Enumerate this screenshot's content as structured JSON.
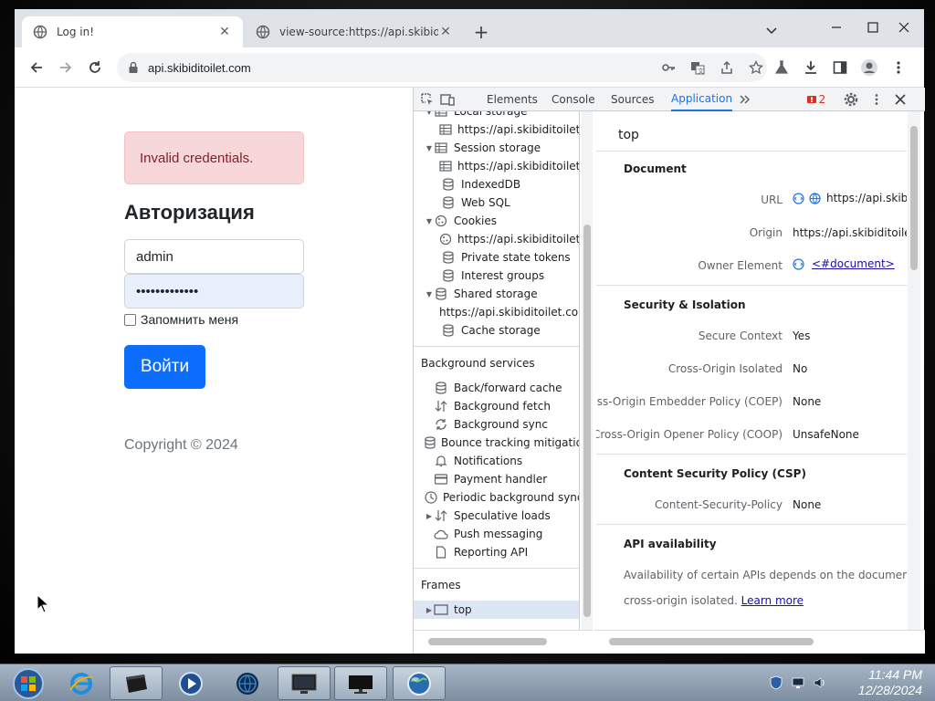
{
  "browser": {
    "tabs": [
      {
        "title": "Log in!",
        "active": true
      },
      {
        "title": "view-source:https://api.skibiditoilet.com",
        "active": false
      }
    ],
    "address": "api.skibiditoilet.com"
  },
  "page": {
    "alert": "Invalid credentials.",
    "title": "Авторизация",
    "username_value": "admin",
    "password_value": "•••••••••••••",
    "remember_label": "Запомнить меня",
    "submit_label": "Войти",
    "copyright": "Copyright © 2024"
  },
  "devtools": {
    "tabs": [
      "Elements",
      "Console",
      "Sources",
      "Application"
    ],
    "active_tab": "Application",
    "issues_count": "2",
    "storage_tree": [
      {
        "label": "Local storage",
        "icon": "table-icon",
        "expanded": true
      },
      {
        "label": "https://api.skibiditoilet.com",
        "icon": "table-icon"
      },
      {
        "label": "Session storage",
        "icon": "table-icon",
        "expanded": true
      },
      {
        "label": "https://api.skibiditoilet.com",
        "icon": "table-icon"
      },
      {
        "label": "IndexedDB",
        "icon": "database-icon"
      },
      {
        "label": "Web SQL",
        "icon": "database-icon"
      },
      {
        "label": "Cookies",
        "icon": "cookie-icon",
        "expanded": true
      },
      {
        "label": "https://api.skibiditoilet.com",
        "icon": "cookie-icon"
      },
      {
        "label": "Private state tokens",
        "icon": "database-icon"
      },
      {
        "label": "Interest groups",
        "icon": "database-icon"
      },
      {
        "label": "Shared storage",
        "icon": "database-icon",
        "expanded": true
      },
      {
        "label": "https://api.skibiditoilet.com",
        "icon": ""
      },
      {
        "label": "Cache storage",
        "icon": "database-icon"
      }
    ],
    "background_services_heading": "Background services",
    "background_services": [
      {
        "label": "Back/forward cache",
        "icon": "database-icon"
      },
      {
        "label": "Background fetch",
        "icon": "arrows-icon"
      },
      {
        "label": "Background sync",
        "icon": "sync-icon"
      },
      {
        "label": "Bounce tracking mitigations",
        "icon": "database-icon"
      },
      {
        "label": "Notifications",
        "icon": "bell-icon"
      },
      {
        "label": "Payment handler",
        "icon": "card-icon"
      },
      {
        "label": "Periodic background sync",
        "icon": "clock-icon"
      },
      {
        "label": "Speculative loads",
        "icon": "arrows-icon"
      },
      {
        "label": "Push messaging",
        "icon": "cloud-icon"
      },
      {
        "label": "Reporting API",
        "icon": "file-icon"
      }
    ],
    "frames_heading": "Frames",
    "frames_top": "top",
    "detail": {
      "title": "top",
      "document_heading": "Document",
      "url_label": "URL",
      "url_value": "https://api.skibiditoilet.com/",
      "origin_label": "Origin",
      "origin_value": "https://api.skibiditoilet.com",
      "owner_label": "Owner Element",
      "owner_value": "<#document>",
      "security_heading": "Security & Isolation",
      "secure_context_label": "Secure Context",
      "secure_context_value": "Yes",
      "coi_label": "Cross-Origin Isolated",
      "coi_value": "No",
      "coep_label": "Cross-Origin Embedder Policy (COEP)",
      "coep_value": "None",
      "coop_label": "Cross-Origin Opener Policy (COOP)",
      "coop_value": "UnsafeNone",
      "csp_heading": "Content Security Policy (CSP)",
      "csp_label": "Content-Security-Policy",
      "csp_value": "None",
      "api_heading": "API availability",
      "api_text_1": "Availability of certain APIs depends on the document being",
      "api_text_2": "cross-origin isolated.",
      "api_link": "Learn more"
    }
  },
  "taskbar": {
    "time": "11:44 PM",
    "date": "12/28/2024"
  },
  "colors": {
    "primary_button": "#0d6efd",
    "alert_bg": "#f8d7da",
    "devtools_accent": "#1a73e8"
  }
}
